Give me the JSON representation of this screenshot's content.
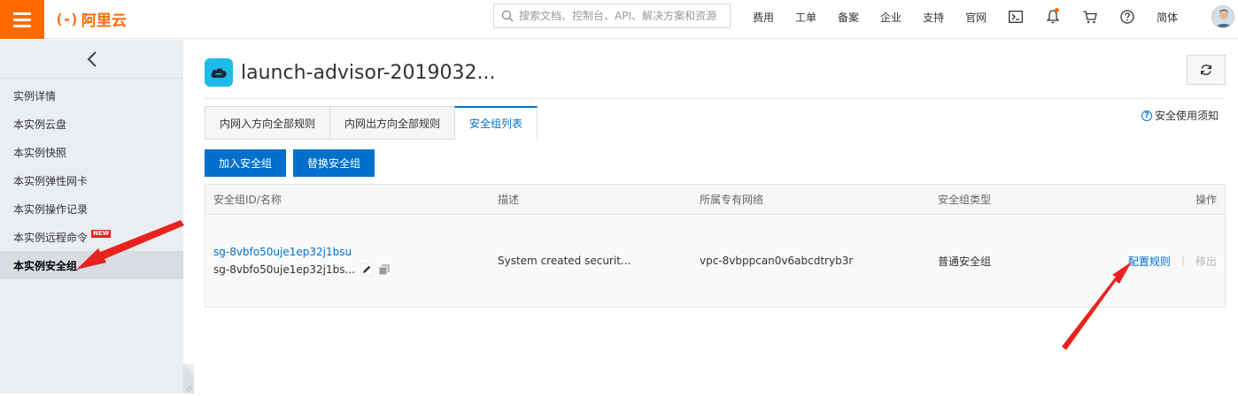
{
  "topbar": {
    "logo_mark": "(-)",
    "logo_text": "阿里云",
    "search_placeholder": "搜索文档、控制台、API、解决方案和资源",
    "nav": [
      "费用",
      "工单",
      "备案",
      "企业",
      "支持",
      "官网"
    ],
    "icons": [
      "terminal-icon",
      "bell-icon",
      "cart-icon",
      "help-icon"
    ],
    "lang": "简体",
    "accent": "#ff6a00"
  },
  "sidebar": {
    "items": [
      {
        "label": "实例详情"
      },
      {
        "label": "本实例云盘"
      },
      {
        "label": "本实例快照"
      },
      {
        "label": "本实例弹性网卡"
      },
      {
        "label": "本实例操作记录"
      },
      {
        "label": "本实例远程命令",
        "badge": "NEW"
      },
      {
        "label": "本实例安全组"
      }
    ],
    "active_index": 6
  },
  "main": {
    "title": "launch-advisor-2019032...",
    "tabs": [
      {
        "label": "内网入方向全部规则"
      },
      {
        "label": "内网出方向全部规则"
      },
      {
        "label": "安全组列表"
      }
    ],
    "active_tab": 2,
    "help_link": "安全使用须知",
    "buttons": {
      "add": "加入安全组",
      "replace": "替换安全组"
    },
    "table": {
      "headers": [
        "安全组ID/名称",
        "描述",
        "所属专有网络",
        "安全组类型",
        "操作"
      ],
      "rows": [
        {
          "id": "sg-8vbfo50uje1ep32j1bsu",
          "name": "sg-8vbfo50uje1ep32j1bs...",
          "description": "System created securit...",
          "vpc": "vpc-8vbppcan0v6abcdtryb3r",
          "type": "普通安全组",
          "op_configure": "配置规则",
          "op_remove": "移出"
        }
      ]
    }
  },
  "colors": {
    "link": "#0070cc",
    "annotation": "#e8231f"
  }
}
